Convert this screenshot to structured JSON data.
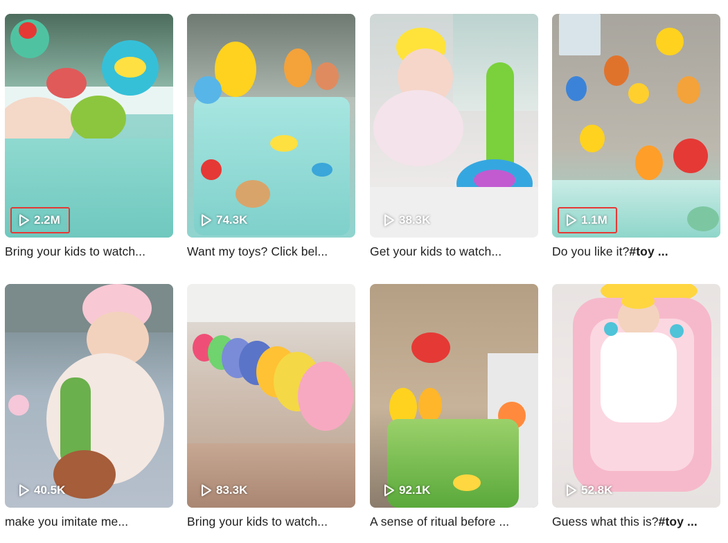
{
  "colors": {
    "highlight_border": "#e53935",
    "caption_text": "#1f1f1f",
    "view_count_text": "#ffffff"
  },
  "icons": {
    "view_count": "play-icon"
  },
  "videos": [
    {
      "views": "2.2M",
      "caption": "Bring your kids to watch...",
      "caption_tag": "",
      "highlighted": true
    },
    {
      "views": "74.3K",
      "caption": "Want my toys? Click bel...",
      "caption_tag": "",
      "highlighted": false
    },
    {
      "views": "38.3K",
      "caption": "Get your kids to watch...",
      "caption_tag": "",
      "highlighted": false
    },
    {
      "views": "1.1M",
      "caption": "Do you like it?",
      "caption_tag": "#toy ...",
      "highlighted": true
    },
    {
      "views": "40.5K",
      "caption": "make you imitate me...",
      "caption_tag": "",
      "highlighted": false
    },
    {
      "views": "83.3K",
      "caption": "Bring your kids to watch...",
      "caption_tag": "",
      "highlighted": false
    },
    {
      "views": "92.1K",
      "caption": "A sense of ritual before ...",
      "caption_tag": "",
      "highlighted": false
    },
    {
      "views": "52.8K",
      "caption": "Guess what this is?",
      "caption_tag": "#toy ...",
      "highlighted": false
    }
  ]
}
